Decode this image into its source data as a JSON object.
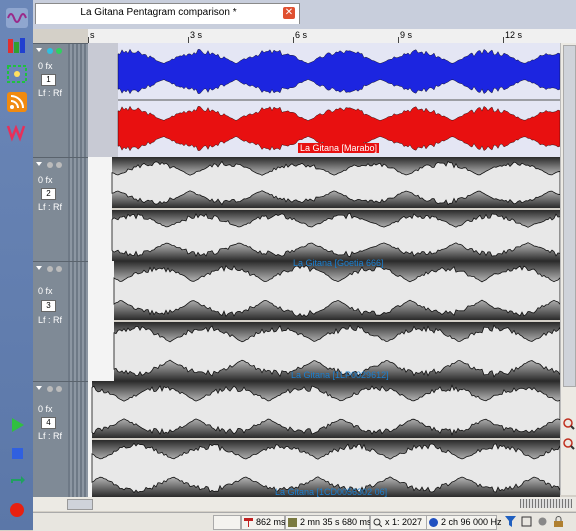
{
  "window": {
    "tab_title": "La Gitana Pentagram comparison *",
    "close_glyph": "✕"
  },
  "ruler": {
    "labels": [
      "s",
      "3 s",
      "6 s",
      "9 s",
      "12 s"
    ]
  },
  "tracks": [
    {
      "fx": "0 fx",
      "number": "1",
      "routing": "Lf : Rf",
      "clip_label": "La Gitana [Marabo]",
      "top_color": "#1c25e0",
      "bottom_color": "#e81010"
    },
    {
      "fx": "0 fx",
      "number": "2",
      "routing": "Lf : Rf",
      "clip_label": "La Gitana [Goetia 666]"
    },
    {
      "fx": "0 fx",
      "number": "3",
      "routing": "Lf : Rf",
      "clip_label": "La Gitana [1LP0029612]"
    },
    {
      "fx": "0 fx",
      "number": "4",
      "routing": "Lf : Rf",
      "clip_label": "La Gitana [1CD0056302 06]"
    }
  ],
  "status": {
    "latency": "862 ms",
    "duration": "2 mn 35 s 680 ms",
    "zoom": "x 1: 2027",
    "format": "2 ch 96 000 Hz"
  },
  "colors": {
    "accent_blue": "#1c25e0",
    "accent_red": "#e81010",
    "clip_label_blue": "#1a7fd0"
  }
}
